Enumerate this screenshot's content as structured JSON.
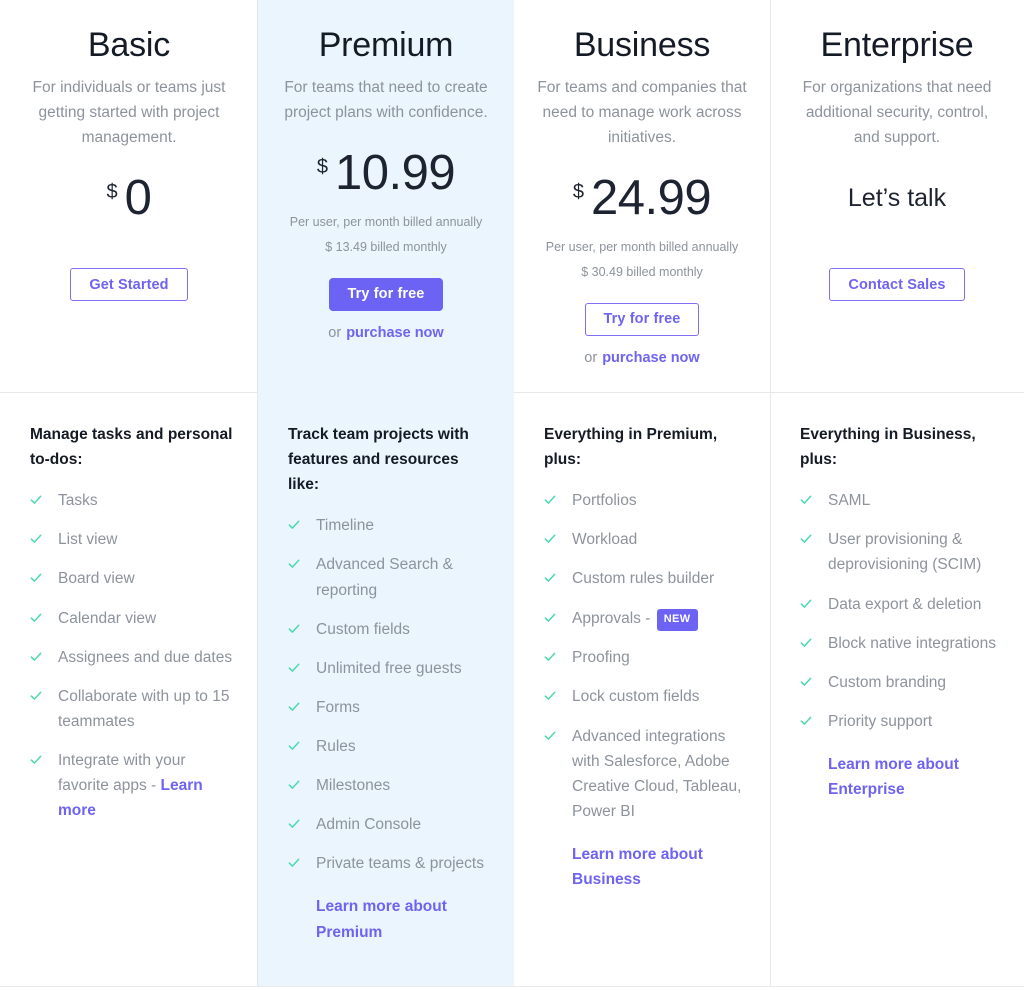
{
  "colors": {
    "accent_purple": "#6c63f5",
    "link_purple": "#6f63f2",
    "check_green": "#4ed8b0",
    "highlight_bg": "#eaf5fd",
    "text_dark": "#151b26",
    "text_muted": "#8d939c",
    "divider": "#e6e8ec"
  },
  "plans": [
    {
      "name": "Basic",
      "description": "For individuals or teams just getting started with project management.",
      "currency": "$",
      "price": "0",
      "billing_annual": "",
      "billing_monthly": "",
      "cta_label": "Get Started",
      "cta_style": "outline",
      "or_prefix": "",
      "or_link": "",
      "features_title": "Manage tasks and personal to-dos:",
      "features": [
        {
          "text": "Tasks"
        },
        {
          "text": "List view"
        },
        {
          "text": "Board view"
        },
        {
          "text": "Calendar view"
        },
        {
          "text": "Assignees and due dates"
        },
        {
          "text": "Collaborate with up to 15 teammates"
        },
        {
          "text": "Integrate with your favorite apps - ",
          "link": "Learn more"
        }
      ],
      "learn_more": ""
    },
    {
      "name": "Premium",
      "description": "For teams that need to create project plans with confidence.",
      "currency": "$",
      "price": "10.99",
      "billing_annual": "Per user, per month billed annually",
      "billing_monthly": "$ 13.49 billed monthly",
      "cta_label": "Try for free",
      "cta_style": "solid",
      "or_prefix": "or",
      "or_link": "purchase now",
      "features_title": "Track team projects with features and resources like:",
      "features": [
        {
          "text": "Timeline"
        },
        {
          "text": "Advanced Search & reporting"
        },
        {
          "text": "Custom fields"
        },
        {
          "text": "Unlimited free guests"
        },
        {
          "text": "Forms"
        },
        {
          "text": "Rules"
        },
        {
          "text": "Milestones"
        },
        {
          "text": "Admin Console"
        },
        {
          "text": "Private teams & projects"
        }
      ],
      "learn_more": "Learn more about Premium"
    },
    {
      "name": "Business",
      "description": "For teams and companies that need to manage work across initiatives.",
      "currency": "$",
      "price": "24.99",
      "billing_annual": "Per user, per month billed annually",
      "billing_monthly": "$ 30.49 billed monthly",
      "cta_label": "Try for free",
      "cta_style": "outline",
      "or_prefix": "or",
      "or_link": "purchase now",
      "features_title": "Everything in Premium, plus:",
      "features": [
        {
          "text": "Portfolios"
        },
        {
          "text": "Workload"
        },
        {
          "text": "Custom rules builder"
        },
        {
          "text": "Approvals - ",
          "badge": "NEW"
        },
        {
          "text": "Proofing"
        },
        {
          "text": "Lock custom fields"
        },
        {
          "text": "Advanced integrations with Salesforce, Adobe Creative Cloud, Tableau, Power BI"
        }
      ],
      "learn_more": "Learn more about Business"
    },
    {
      "name": "Enterprise",
      "description": "For organizations that need additional security, control, and support.",
      "currency": "",
      "price": "Let’s talk",
      "billing_annual": "",
      "billing_monthly": "",
      "cta_label": "Contact Sales",
      "cta_style": "outline",
      "or_prefix": "",
      "or_link": "",
      "features_title": "Everything in Business, plus:",
      "features": [
        {
          "text": "SAML"
        },
        {
          "text": "User provisioning & deprovisioning (SCIM)"
        },
        {
          "text": "Data export & deletion"
        },
        {
          "text": "Block native integrations"
        },
        {
          "text": "Custom branding"
        },
        {
          "text": "Priority support"
        }
      ],
      "learn_more": "Learn more about Enterprise"
    }
  ]
}
